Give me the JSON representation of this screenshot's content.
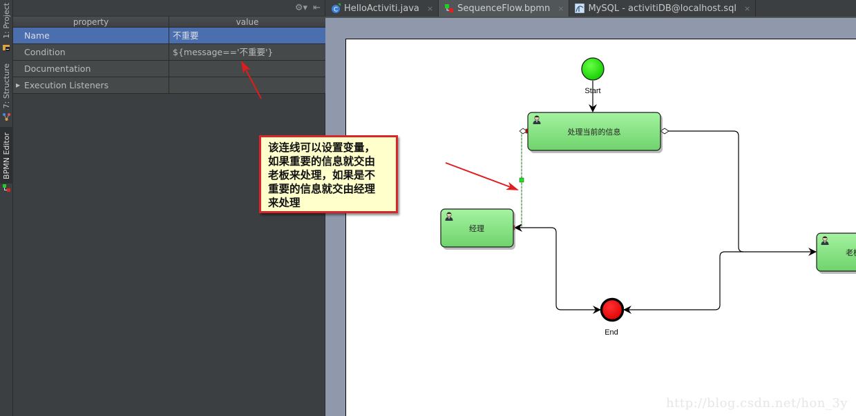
{
  "tool_strip": {
    "tabs": [
      {
        "label": "1: Project",
        "icon": "folder-icon"
      },
      {
        "label": "7: Structure",
        "icon": "structure-icon"
      },
      {
        "label": "BPMN Editor",
        "icon": "bpmn-icon",
        "active": true
      }
    ]
  },
  "properties": {
    "toolbar": {
      "settings_icon": "gear-icon",
      "hide_icon": "hide-panel-icon"
    },
    "columns": [
      "property",
      "value"
    ],
    "rows": [
      {
        "property": "Name",
        "value": "不重要",
        "selected": true
      },
      {
        "property": "Condition",
        "value": "${message=='不重要'}"
      },
      {
        "property": "Documentation",
        "value": ""
      },
      {
        "property": "Execution Listeners",
        "value": "",
        "expandable": true
      }
    ]
  },
  "editor_tabs": [
    {
      "label": "HelloActiviti.java",
      "icon": "java-class-icon",
      "close": "×"
    },
    {
      "label": "SequenceFlow.bpmn",
      "icon": "bpmn-file-icon",
      "close": "×",
      "active": true
    },
    {
      "label": "MySQL - activitiDB@localhost.sql",
      "icon": "mysql-icon",
      "close": "×"
    }
  ],
  "diagram": {
    "start_event": {
      "label": "Start",
      "color": "#22dd11"
    },
    "end_event": {
      "label": "End",
      "color": "#ee1111"
    },
    "tasks": [
      {
        "id": "task-process-info",
        "label": "处理当前的信息",
        "type": "user-task"
      },
      {
        "id": "task-manager",
        "label": "经理",
        "type": "user-task"
      },
      {
        "id": "task-boss",
        "label": "老板",
        "type": "user-task"
      }
    ],
    "task_fill": "#8ee88e"
  },
  "annotation": {
    "lines": [
      "该连线可以设置变量，",
      "如果重要的信息就交由",
      "老板来处理，如果是不",
      "重要的信息就交由经理",
      "来处理"
    ]
  },
  "watermark": "http://blog.csdn.net/hon_3y"
}
